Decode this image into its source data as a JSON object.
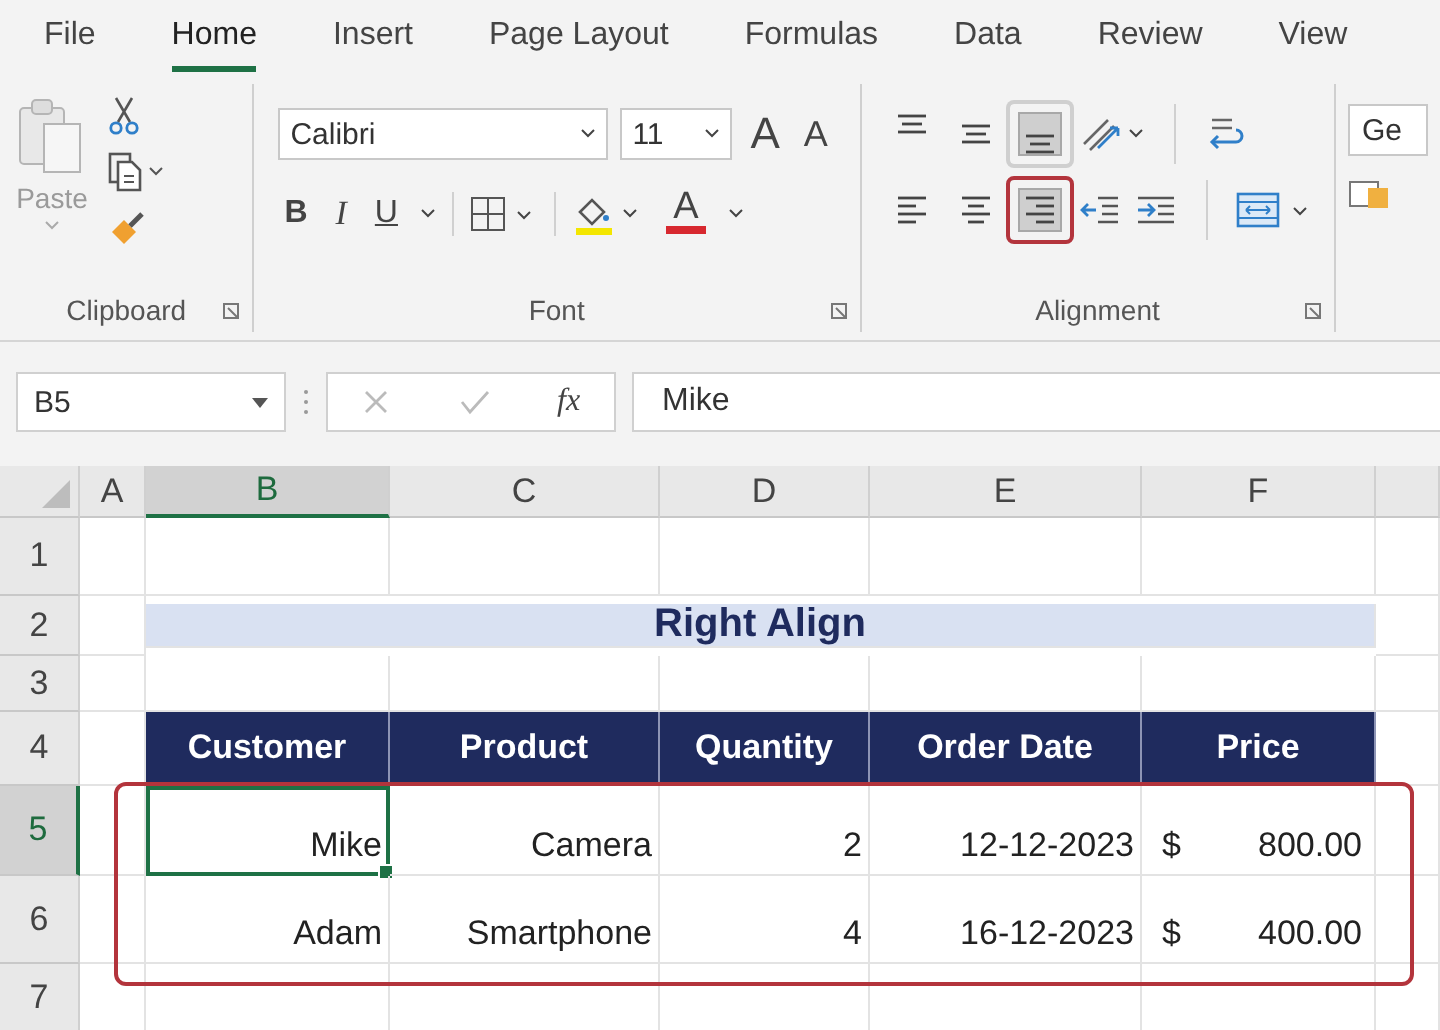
{
  "tabs": [
    {
      "label": "File",
      "selected": false
    },
    {
      "label": "Home",
      "selected": true
    },
    {
      "label": "Insert",
      "selected": false
    },
    {
      "label": "Page Layout",
      "selected": false
    },
    {
      "label": "Formulas",
      "selected": false
    },
    {
      "label": "Data",
      "selected": false
    },
    {
      "label": "Review",
      "selected": false
    },
    {
      "label": "View",
      "selected": false
    }
  ],
  "clipboard": {
    "label": "Clipboard",
    "paste_label": "Paste"
  },
  "font": {
    "label": "Font",
    "name": "Calibri",
    "size": "11",
    "grow": "A",
    "shrink": "A",
    "bold": "B",
    "italic": "I",
    "underline": "U",
    "font_color": "A"
  },
  "alignment": {
    "label": "Alignment",
    "top_row": [
      {
        "kind": "top",
        "selected": false,
        "highlighted": false
      },
      {
        "kind": "middle",
        "selected": false,
        "highlighted": false
      },
      {
        "kind": "bottom",
        "selected": true,
        "highlighted": false
      }
    ],
    "bottom_row": [
      {
        "kind": "left",
        "selected": false,
        "highlighted": false
      },
      {
        "kind": "center",
        "selected": false,
        "highlighted": false
      },
      {
        "kind": "right",
        "selected": true,
        "highlighted": true
      }
    ]
  },
  "number": {
    "format": "Ge"
  },
  "formula_bar": {
    "name_box": "B5",
    "fx": "fx",
    "value": "Mike"
  },
  "columns": [
    {
      "label": "A",
      "selected": false
    },
    {
      "label": "B",
      "selected": true
    },
    {
      "label": "C",
      "selected": false
    },
    {
      "label": "D",
      "selected": false
    },
    {
      "label": "E",
      "selected": false
    },
    {
      "label": "F",
      "selected": false
    }
  ],
  "row_headers": [
    {
      "label": "1",
      "selected": false
    },
    {
      "label": "2",
      "selected": false
    },
    {
      "label": "3",
      "selected": false
    },
    {
      "label": "4",
      "selected": false
    },
    {
      "label": "5",
      "selected": true
    },
    {
      "label": "6",
      "selected": false
    },
    {
      "label": "7",
      "selected": false
    }
  ],
  "table": {
    "title": "Right Align",
    "headers": [
      "Customer",
      "Product",
      "Quantity",
      "Order Date",
      "Price"
    ],
    "rows_highlighted": true,
    "rows": [
      {
        "cells": [
          {
            "text": "Mike",
            "selected": true
          },
          {
            "text": "Camera",
            "selected": false
          },
          {
            "text": "2",
            "selected": false
          },
          {
            "text": "12-12-2023",
            "selected": false
          }
        ],
        "currency": "$",
        "price": "800.00"
      },
      {
        "cells": [
          {
            "text": "Adam",
            "selected": false
          },
          {
            "text": "Smartphone",
            "selected": false
          },
          {
            "text": "4",
            "selected": false
          },
          {
            "text": "16-12-2023",
            "selected": false
          }
        ],
        "currency": "$",
        "price": "400.00"
      }
    ]
  }
}
